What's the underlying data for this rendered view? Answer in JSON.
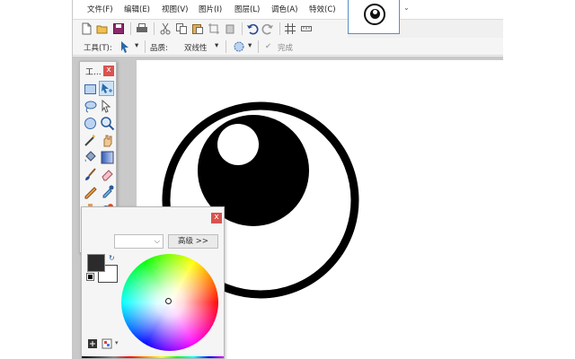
{
  "menu": {
    "items": [
      {
        "label": "文件(F)"
      },
      {
        "label": "编辑(E)"
      },
      {
        "label": "视图(V)"
      },
      {
        "label": "图片(I)"
      },
      {
        "label": "图层(L)"
      },
      {
        "label": "调色(A)"
      },
      {
        "label": "特效(C)"
      }
    ]
  },
  "toolbar": {
    "tool_label": "工具(T):",
    "quality_label": "品质:",
    "quality_value": "双线性",
    "finish_label": "完成"
  },
  "tools_panel": {
    "title": "工...",
    "close": "x"
  },
  "colors_panel": {
    "close": "x",
    "advanced_label": "高级 >>",
    "select_value": ""
  },
  "icons": [
    "new-file-icon",
    "open-file-icon",
    "save-icon",
    "print-icon",
    "cut-icon",
    "copy-icon",
    "paste-icon",
    "crop-icon",
    "delete-icon",
    "undo-icon",
    "redo-icon",
    "grid-icon",
    "rectangle-select-icon",
    "move-selection-icon",
    "lasso-icon",
    "move-selected-icon",
    "ellipse-select-icon",
    "zoom-icon",
    "magic-wand-icon",
    "pan-hand-icon",
    "paint-bucket-icon",
    "gradient-icon",
    "paintbrush-icon",
    "eraser-icon",
    "pencil-icon",
    "color-picker-icon",
    "clone-stamp-icon",
    "recolor-icon",
    "text-icon",
    "line-curve-icon",
    "shapes-icon",
    "eye-drawing"
  ],
  "colors": {
    "accent": "#5a8ec5",
    "close_red": "#d9534f",
    "selected_tool": "#cde3f7",
    "primary_color": "#2b2b2b",
    "secondary_color": "#ffffff"
  }
}
